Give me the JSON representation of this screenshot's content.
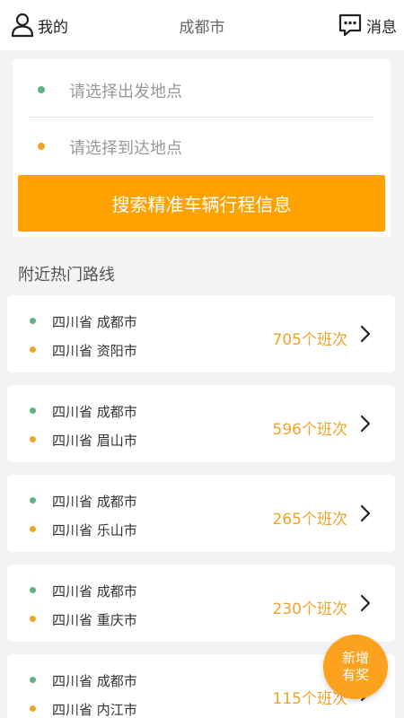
{
  "header": {
    "profile_label": "我的",
    "city": "成都市",
    "messages_label": "消息"
  },
  "search": {
    "departure_placeholder": "请选择出发地点",
    "arrival_placeholder": "请选择到达地点",
    "button_label": "搜索精准车辆行程信息",
    "departure_dot_color": "#5fb37f",
    "arrival_dot_color": "#f2a42b",
    "accent_color": "#ffa200"
  },
  "section": {
    "title": "附近热门路线"
  },
  "routes": [
    {
      "from": "四川省 成都市",
      "to": "四川省 资阳市",
      "count": "705个班次"
    },
    {
      "from": "四川省 成都市",
      "to": "四川省 眉山市",
      "count": "596个班次"
    },
    {
      "from": "四川省 成都市",
      "to": "四川省 乐山市",
      "count": "265个班次"
    },
    {
      "from": "四川省 成都市",
      "to": "四川省 重庆市",
      "count": "230个班次"
    },
    {
      "from": "四川省 成都市",
      "to": "四川省 内江市",
      "count": "115个班次"
    }
  ],
  "fab": {
    "line1": "新增",
    "line2": "有奖"
  }
}
